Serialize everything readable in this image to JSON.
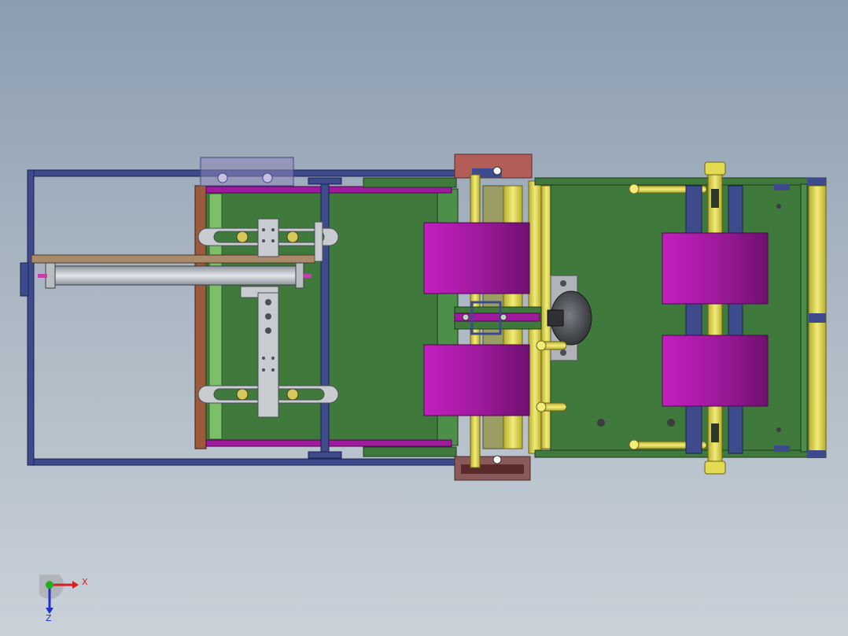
{
  "viewport": {
    "background_top": "#8b9db1",
    "background_bottom": "#c9d1d9"
  },
  "palette": {
    "frame": "#3d4a8c",
    "plate": "#3f7a3c",
    "roller_yellow": "#e3dc52",
    "drum_magenta": "#a01a9e",
    "motor": "#4a4d52",
    "copper": "#9c5a3c",
    "steel": "#c8ccd0"
  },
  "triad": {
    "x_label": "X",
    "z_label": "Z",
    "x_color": "#d42020",
    "y_color": "#22b022",
    "z_color": "#2030c8"
  }
}
